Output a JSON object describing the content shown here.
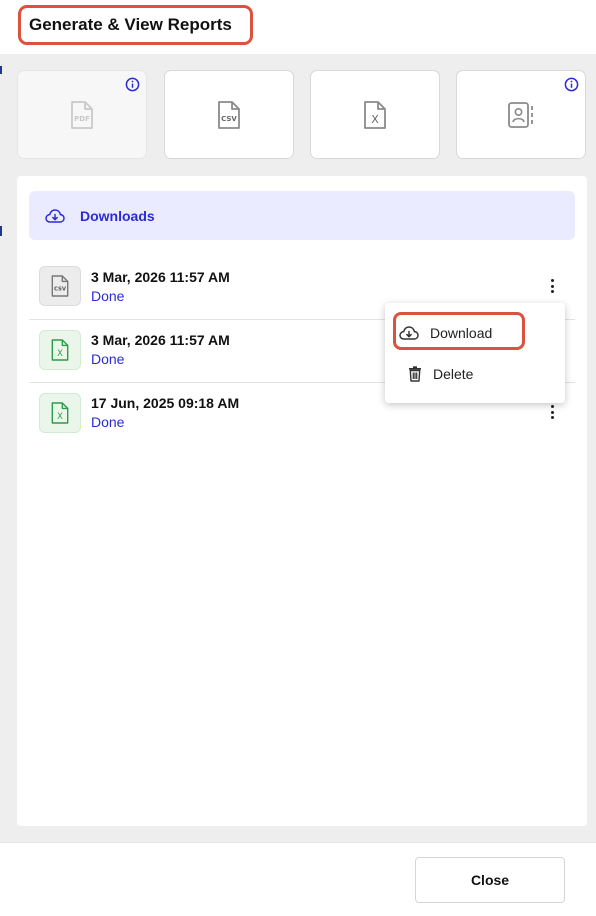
{
  "header": {
    "title": "Generate & View Reports"
  },
  "report_types": [
    {
      "icon": "pdf-file-icon",
      "label": "PDF",
      "disabled": true,
      "info": true
    },
    {
      "icon": "csv-file-icon",
      "label": "CSV",
      "disabled": false,
      "info": false
    },
    {
      "icon": "excel-file-icon",
      "label": "X",
      "disabled": false,
      "info": false
    },
    {
      "icon": "contact-card-icon",
      "label": "",
      "disabled": false,
      "info": true
    }
  ],
  "downloads": {
    "label": "Downloads",
    "items": [
      {
        "type": "CSV",
        "date": "3 Mar, 2026 11:57 AM",
        "status": "Done"
      },
      {
        "type": "X",
        "date": "3 Mar, 2026 11:57 AM",
        "status": "Done"
      },
      {
        "type": "X",
        "date": "17 Jun, 2025 09:18 AM",
        "status": "Done"
      }
    ]
  },
  "context_menu": {
    "download_label": "Download",
    "delete_label": "Delete"
  },
  "footer": {
    "close_label": "Close"
  },
  "colors": {
    "accent": "#2b2bd6",
    "highlight": "#d9533f",
    "excel_green": "#2e9b4a"
  }
}
